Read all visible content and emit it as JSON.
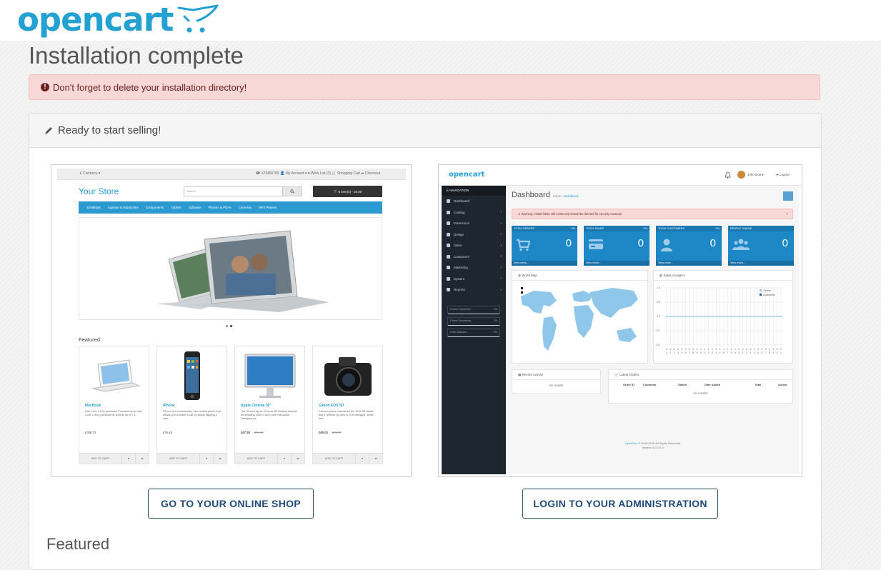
{
  "brand": {
    "logo_text": "opencart",
    "accent": "#23a1d1"
  },
  "page": {
    "title": "Installation complete",
    "alert": "Don't forget to delete your installation directory!",
    "panel_heading": "Ready to start selling!",
    "shop_button": "GO TO YOUR ONLINE SHOP",
    "admin_button": "LOGIN TO YOUR ADMINISTRATION",
    "featured_heading": "Featured"
  },
  "store_preview": {
    "currency": "£ Currency ▾",
    "top_links": "☎ 123456789  👤 My Account ▾  ♥ Wish List (0)  🛒 Shopping Cart  ➦ Checkout",
    "store_name": "Your Store",
    "search_placeholder": "Search",
    "cart": "0 item(s) - £0.00",
    "menu": [
      "Desktops",
      "Laptops & Notebooks",
      "Components",
      "Tablets",
      "Software",
      "Phones & PDAs",
      "Cameras",
      "MP3 Players"
    ],
    "featured": "Featured",
    "add_to_cart": "ADD TO CART",
    "products": [
      {
        "name": "MacBook",
        "desc": "Intel Core 2 Duo processor Powered by an Intel Core 2 Duo processor at speeds up to 2.1..",
        "price": "£368.73",
        "old": ""
      },
      {
        "name": "iPhone",
        "desc": "iPhone is a revolutionary new mobile phone that allows you to make a call by simply tapping a nam..",
        "price": "£75.46",
        "old": ""
      },
      {
        "name": "Apple Cinema 30\"",
        "desc": "The 30-inch Apple Cinema HD Display delivers an amazing 2560 x 1600 pixel resolution. Designed sp..",
        "price": "£67.38",
        "old": "£74.73"
      },
      {
        "name": "Canon EOS 5D",
        "desc": "Canon's press material for the EOS 5D states that it 'defines (a) new D-SLR category', while we'r..",
        "price": "£60.03",
        "old": "£74.73"
      }
    ]
  },
  "admin_preview": {
    "logo": "opencart",
    "user": "John Doe ▾",
    "logout": "Logout",
    "nav_header": "☰ NAVIGATION",
    "nav": [
      "Dashboard",
      "Catalog",
      "Extensions",
      "Design",
      "Sales",
      "Customers",
      "Marketing",
      "System",
      "Reports"
    ],
    "stats": [
      {
        "label": "Orders Completed",
        "pct": "0%"
      },
      {
        "label": "Orders Processing",
        "pct": "0%"
      },
      {
        "label": "Other Statuses",
        "pct": "0%"
      }
    ],
    "title": "Dashboard",
    "breadcrumb_home": "Home",
    "breadcrumb_sep": "›",
    "breadcrumb_current": "Dashboard",
    "warning": "⊘ Warning: Install folder still exists and should be deleted for security reasons!",
    "warning_close": "×",
    "tiles": [
      {
        "label": "TOTAL ORDERS",
        "pct": "0%",
        "value": "0",
        "more": "View more..."
      },
      {
        "label": "TOTAL SALES",
        "pct": "0%",
        "value": "0",
        "more": "View more..."
      },
      {
        "label": "TOTAL CUSTOMERS",
        "pct": "0%",
        "value": "0",
        "more": "View more..."
      },
      {
        "label": "PEOPLE ONLINE",
        "pct": "",
        "value": "0",
        "more": "View more..."
      }
    ],
    "world_map": "World Map",
    "sales_analytics": "Sales Analytics",
    "legend_orders": "Orders",
    "legend_customers": "Customers",
    "y_ticks": [
      "1.0",
      "0.5",
      "0.0",
      "-0.5",
      "-1.0"
    ],
    "x_ticks": [
      "0",
      "0",
      "0",
      "0",
      "0",
      "0",
      "0",
      "0",
      "0",
      "1",
      "1",
      "1",
      "1",
      "1",
      "1",
      "1",
      "1",
      "1",
      "1",
      "2",
      "2",
      "2",
      "2",
      "2",
      "2",
      "2",
      "2",
      "2",
      "2",
      "3",
      "3"
    ],
    "x_ticks_2": [
      "1",
      "2",
      "3",
      "4",
      "5",
      "6",
      "7",
      "8",
      "9",
      "0",
      "1",
      "2",
      "3",
      "4",
      "5",
      "6",
      "7",
      "8",
      "9",
      "0",
      "1",
      "2",
      "3",
      "4",
      "5",
      "6",
      "7",
      "8",
      "9",
      "0",
      "1"
    ],
    "recent_activity": "Recent Activity",
    "latest_orders": "Latest Orders",
    "no_results": "No results!",
    "order_cols": [
      "Order ID",
      "Customer",
      "Status",
      "Date Added",
      "Total",
      "Action"
    ],
    "footer_link": "OpenCart",
    "footer_copy": "© 2009-2020 All Rights Reserved.",
    "footer_version": "Version 4.0.0.0_b"
  }
}
